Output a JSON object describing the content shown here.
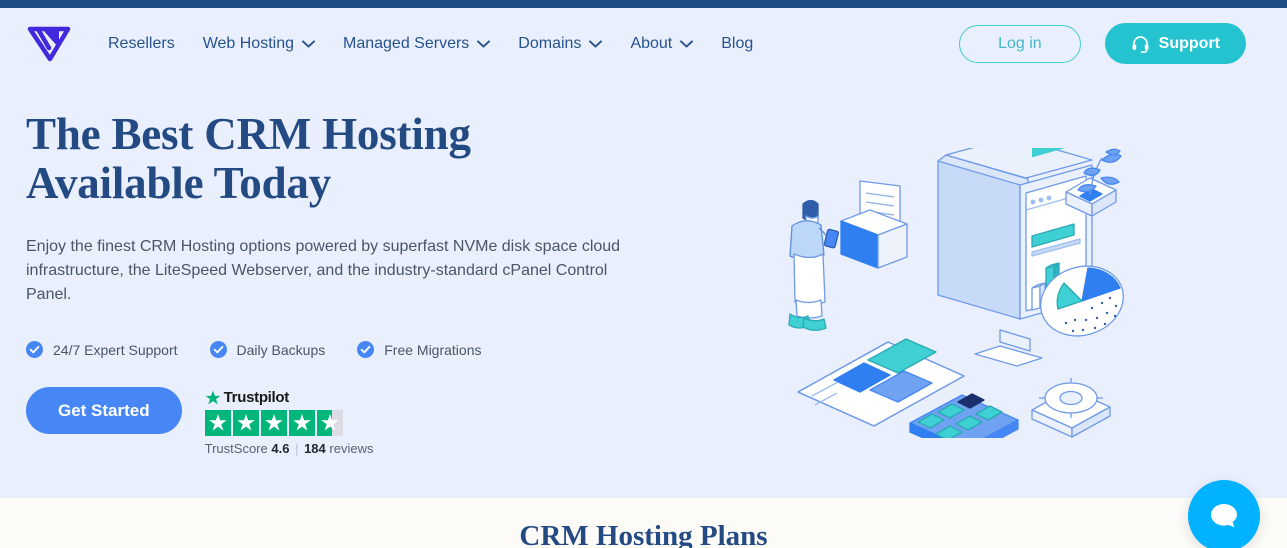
{
  "brand": {
    "logo_icon": "vertex-logo-icon",
    "accent_blue": "#4787f5",
    "accent_teal": "#25c3cf",
    "navy": "#234a82",
    "hero_bg": "#e9effc",
    "plans_bg": "#fdfbf8",
    "chat_blue": "#00b2ff",
    "trustpilot_green": "#00b67a"
  },
  "nav": {
    "items": [
      {
        "label": "Resellers",
        "has_dropdown": false
      },
      {
        "label": "Web Hosting",
        "has_dropdown": true
      },
      {
        "label": "Managed Servers",
        "has_dropdown": true
      },
      {
        "label": "Domains",
        "has_dropdown": true
      },
      {
        "label": "About",
        "has_dropdown": true
      },
      {
        "label": "Blog",
        "has_dropdown": false
      }
    ],
    "login_label": "Log in",
    "support_label": "Support",
    "support_icon": "headset-icon"
  },
  "hero": {
    "title_line1": "The Best CRM Hosting",
    "title_line2": "Available Today",
    "subtitle": "Enjoy the finest CRM Hosting options powered by superfast NVMe disk space cloud infrastructure, the LiteSpeed Webserver, and the industry-standard cPanel Control Panel.",
    "features": [
      "24/7 Expert Support",
      "Daily Backups",
      "Free Migrations"
    ],
    "cta_label": "Get Started",
    "illustration": "isometric-analytics-dashboard-illustration"
  },
  "trustpilot": {
    "wordmark": "Trustpilot",
    "stars_total": 5,
    "stars_filled": 4,
    "stars_partial_fraction": 0.58,
    "score_label": "TrustScore",
    "score_value": "4.6",
    "separator": "|",
    "reviews_count": "184",
    "reviews_label": "reviews"
  },
  "plans": {
    "title": "CRM Hosting Plans"
  },
  "chat": {
    "icon": "chat-bubble-icon"
  }
}
